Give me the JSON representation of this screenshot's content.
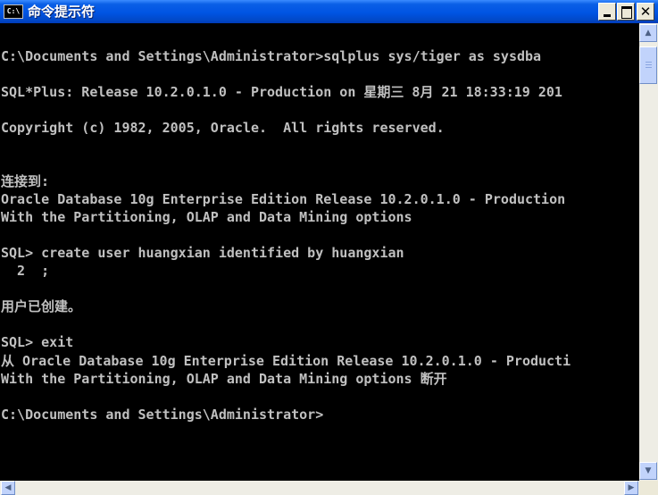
{
  "window": {
    "title": "命令提示符",
    "icon": "C:\\",
    "controls": {
      "minimize": "minimize-icon",
      "maximize": "maximize-icon",
      "close": "close-icon",
      "close_glyph": "✕"
    }
  },
  "console": {
    "lines": [
      "C:\\Documents and Settings\\Administrator>sqlplus sys/tiger as sysdba",
      "SQL*Plus: Release 10.2.0.1.0 - Production on 星期三 8月 21 18:33:19 201",
      "Copyright (c) 1982, 2005, Oracle.  All rights reserved.",
      "连接到:",
      "Oracle Database 10g Enterprise Edition Release 10.2.0.1.0 - Production",
      "With the Partitioning, OLAP and Data Mining options",
      "SQL> create user huangxian identified by huangxian",
      "  2  ;",
      "用户已创建。",
      "SQL> exit",
      "从 Oracle Database 10g Enterprise Edition Release 10.2.0.1.0 - Producti",
      "With the Partitioning, OLAP and Data Mining options 断开",
      "C:\\Documents and Settings\\Administrator>"
    ]
  },
  "scrollbars": {
    "up_arrow": "▲",
    "down_arrow": "▼",
    "left_arrow": "◀",
    "right_arrow": "▶"
  },
  "colors": {
    "title_bar": "#0054e3",
    "console_bg": "#000000",
    "console_text": "#c0c0c0"
  }
}
